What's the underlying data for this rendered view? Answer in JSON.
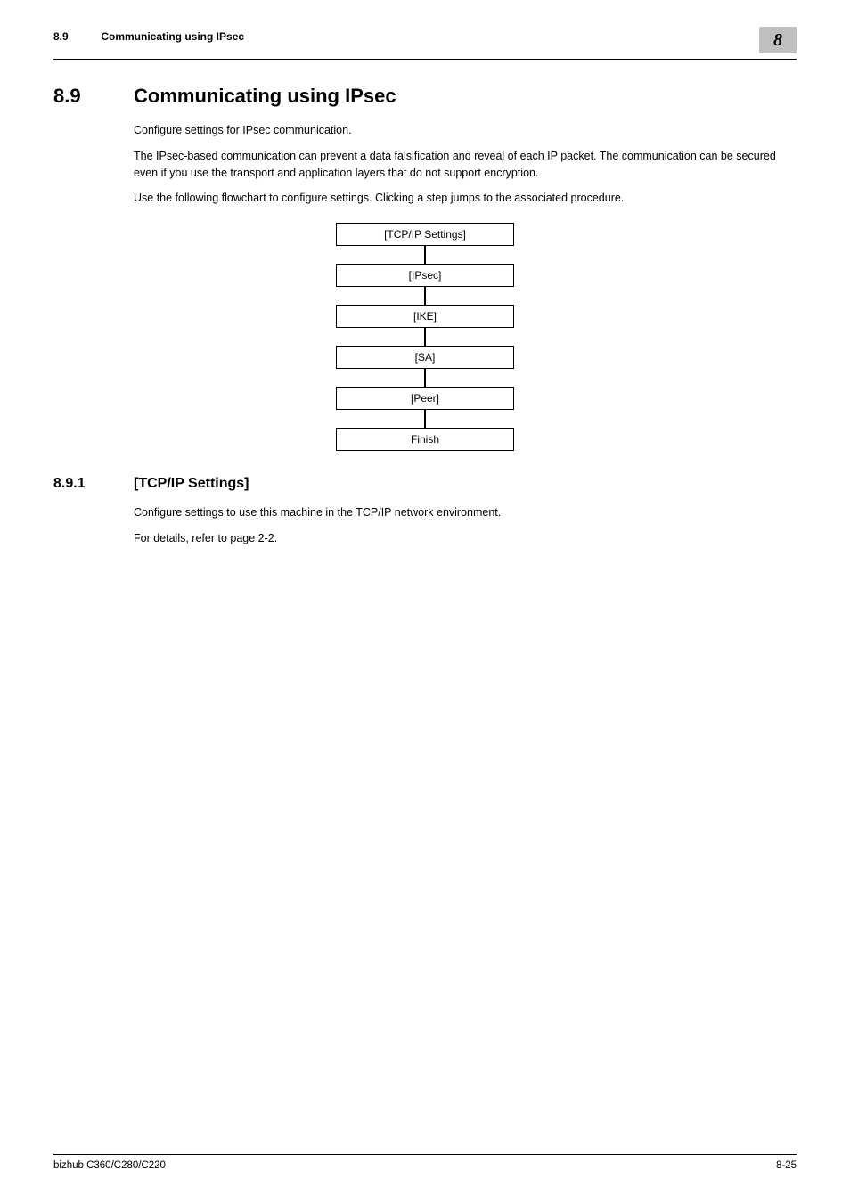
{
  "header": {
    "section_number": "8.9",
    "section_title": "Communicating using IPsec",
    "chapter_number": "8"
  },
  "section": {
    "number": "8.9",
    "title": "Communicating using IPsec",
    "paragraphs": [
      "Configure settings for IPsec communication.",
      "The IPsec-based communication can prevent a data falsification and reveal of each IP packet. The communication can be secured even if you use the transport and application layers that do not support encryption.",
      "Use the following flowchart to configure settings. Clicking a step jumps to the associated procedure."
    ]
  },
  "flowchart": {
    "steps": [
      "[TCP/IP Settings]",
      "[IPsec]",
      "[IKE]",
      "[SA]",
      "[Peer]",
      "Finish"
    ]
  },
  "subsection": {
    "number": "8.9.1",
    "title": "[TCP/IP Settings]",
    "paragraphs": [
      "Configure settings to use this machine in the TCP/IP network environment.",
      "For details, refer to page 2-2."
    ]
  },
  "footer": {
    "left": "bizhub C360/C280/C220",
    "right": "8-25"
  }
}
